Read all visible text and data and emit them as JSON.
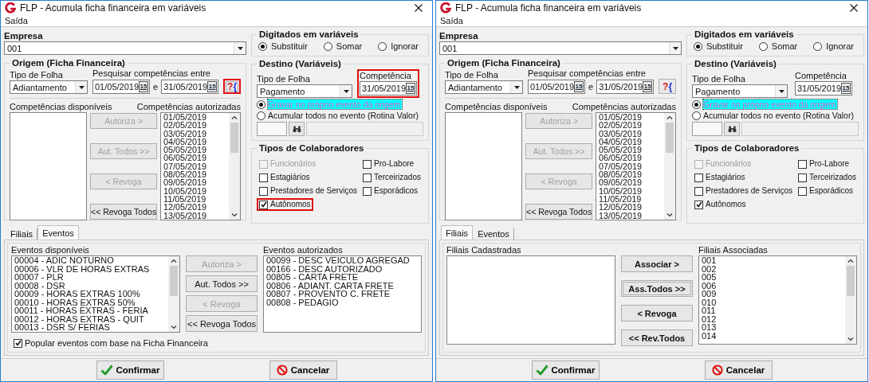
{
  "windows": [
    {
      "title": "FLP - Acumula ficha financeira em variáveis",
      "menu": [
        {
          "label": "Saída"
        }
      ],
      "empresa": {
        "label": "Empresa",
        "value": "001"
      },
      "digitados": {
        "title": "Digitados em variáveis",
        "options": [
          {
            "label": "Substituir",
            "selected": true
          },
          {
            "label": "Somar",
            "selected": false
          },
          {
            "label": "Ignorar",
            "selected": false
          }
        ]
      },
      "origem": {
        "title": "Origem (Ficha Financeira)",
        "tipo_label": "Tipo de Folha",
        "tipo_value": "Adiantamento",
        "range_label": "Pesquisar competências entre",
        "date_from": "01/05/2019",
        "range_separator": "e",
        "date_to": "31/05/2019",
        "picker_from": "15",
        "picker_to": "15",
        "help": {
          "label": "?{",
          "highlighted": true
        },
        "available": {
          "label": "Competências disponíveis"
        },
        "authorized": {
          "label": "Competências autorizadas",
          "scrollable": true,
          "items": [
            "01/05/2019",
            "02/05/2019",
            "03/05/2019",
            "04/05/2019",
            "05/05/2019",
            "06/05/2019",
            "07/05/2019",
            "08/05/2019",
            "09/05/2019",
            "10/05/2019",
            "11/05/2019",
            "12/05/2019",
            "13/05/2019"
          ]
        },
        "buttons": [
          {
            "label": "Autoriza >",
            "disabled": true
          },
          {
            "label": "Aut. Todos >>",
            "disabled": true
          },
          {
            "label": "< Revoga",
            "disabled": true
          },
          {
            "label": "<< Revoga Todos",
            "disabled": false
          }
        ]
      },
      "destino": {
        "title": "Destino (Variáveis)",
        "tipo_label": "Tipo de Folha",
        "tipo_value": "Pagamento",
        "competencia_label": "Competência",
        "competencia_value": "31/05/2019",
        "picker": "15",
        "highlighted": true,
        "options": [
          {
            "label": "Gravar no próprio evento da origem",
            "selected": true,
            "focused": true
          },
          {
            "label": "Acumular todos no evento (Rotina Valor)",
            "selected": false,
            "focused": false
          }
        ]
      },
      "tipos": {
        "title": "Tipos de Colaboradores",
        "items": [
          {
            "label": "Funcionários",
            "checked": false,
            "disabled": true,
            "highlighted": false
          },
          {
            "label": "Pro-Labore",
            "checked": false,
            "disabled": false,
            "highlighted": false
          },
          {
            "label": "Estagiários",
            "checked": false,
            "disabled": false,
            "highlighted": false
          },
          {
            "label": "Terceirizados",
            "checked": false,
            "disabled": false,
            "highlighted": false
          },
          {
            "label": "Prestadores de Serviços",
            "checked": false,
            "disabled": false,
            "highlighted": false
          },
          {
            "label": "Esporádicos",
            "checked": false,
            "disabled": false,
            "highlighted": false
          },
          {
            "label": "Autônomos",
            "checked": true,
            "disabled": false,
            "highlighted": true
          }
        ]
      },
      "tabs": [
        {
          "label": "Filiais",
          "selected": false
        },
        {
          "label": "Eventos",
          "selected": true
        }
      ],
      "panel": {
        "kind": "eventos",
        "left": {
          "label": "Eventos disponíveis",
          "scrollable": true,
          "items": [
            "00004 - ADIC NOTURNO",
            "00006 - VLR DE HORAS EXTRAS",
            "00007 - PLR",
            "00008 - DSR",
            "00009 - HORAS EXTRAS 100%",
            "00010 - HORAS EXTRAS 50%",
            "00011 - HORAS EXTRAS - FERIA",
            "00012 - HORAS EXTRAS - QUIT",
            "00013 - DSR S/ FERIAS"
          ]
        },
        "buttons": [
          {
            "label": "Autoriza >",
            "disabled": true
          },
          {
            "label": "Aut. Todos >>",
            "disabled": false
          },
          {
            "label": "< Revoga",
            "disabled": true
          },
          {
            "label": "<< Revoga Todos",
            "disabled": false
          }
        ],
        "right": {
          "label": "Eventos autorizados",
          "scrollable": false,
          "items": [
            "00099 - DESC VEICULO AGREGAD",
            "00166 - DESC AUTORIZADO",
            "00805 - CARTA FRETE",
            "00806 - ADIANT. CARTA FRETE",
            "00807 - PROVENTO C. FRETE",
            "00808 - PEDAGIO"
          ]
        },
        "option": {
          "label": "Popular eventos com base na Ficha Financeira",
          "checked": true
        }
      },
      "footer": [
        {
          "kind": "confirm",
          "label": "Confirmar"
        },
        {
          "kind": "cancel",
          "label": "Cancelar"
        }
      ]
    },
    {
      "title": "FLP - Acumula ficha financeira em variáveis",
      "menu": [
        {
          "label": "Saída"
        }
      ],
      "empresa": {
        "label": "Empresa",
        "value": "001"
      },
      "digitados": {
        "title": "Digitados em variáveis",
        "options": [
          {
            "label": "Substituir",
            "selected": true
          },
          {
            "label": "Somar",
            "selected": false
          },
          {
            "label": "Ignorar",
            "selected": false
          }
        ]
      },
      "origem": {
        "title": "Origem (Ficha Financeira)",
        "tipo_label": "Tipo de Folha",
        "tipo_value": "Adiantamento",
        "range_label": "Pesquisar competências entre",
        "date_from": "01/05/2019",
        "range_separator": "e",
        "date_to": "31/05/2019",
        "picker_from": "15",
        "picker_to": "15",
        "help": {
          "label": "?{",
          "highlighted": false
        },
        "available": {
          "label": "Competências disponíveis"
        },
        "authorized": {
          "label": "Competências autorizadas",
          "scrollable": true,
          "items": [
            "01/05/2019",
            "02/05/2019",
            "03/05/2019",
            "04/05/2019",
            "05/05/2019",
            "06/05/2019",
            "07/05/2019",
            "08/05/2019",
            "09/05/2019",
            "10/05/2019",
            "11/05/2019",
            "12/05/2019",
            "13/05/2019"
          ]
        },
        "buttons": [
          {
            "label": "Autoriza >",
            "disabled": true
          },
          {
            "label": "Aut. Todos >>",
            "disabled": true
          },
          {
            "label": "< Revoga",
            "disabled": true
          },
          {
            "label": "<< Revoga Todos",
            "disabled": false
          }
        ]
      },
      "destino": {
        "title": "Destino (Variáveis)",
        "tipo_label": "Tipo de Folha",
        "tipo_value": "Pagamento",
        "competencia_label": "Competência",
        "competencia_value": "31/05/2019",
        "picker": "15",
        "highlighted": false,
        "options": [
          {
            "label": "Gravar no próprio evento da origem",
            "selected": true,
            "focused": true
          },
          {
            "label": "Acumular todos no evento (Rotina Valor)",
            "selected": false,
            "focused": false
          }
        ]
      },
      "tipos": {
        "title": "Tipos de Colaboradores",
        "items": [
          {
            "label": "Funcionários",
            "checked": false,
            "disabled": true,
            "highlighted": false
          },
          {
            "label": "Pro-Labore",
            "checked": false,
            "disabled": false,
            "highlighted": false
          },
          {
            "label": "Estagiários",
            "checked": false,
            "disabled": false,
            "highlighted": false
          },
          {
            "label": "Terceirizados",
            "checked": false,
            "disabled": false,
            "highlighted": false
          },
          {
            "label": "Prestadores de Serviços",
            "checked": false,
            "disabled": false,
            "highlighted": false
          },
          {
            "label": "Esporádicos",
            "checked": false,
            "disabled": false,
            "highlighted": false
          },
          {
            "label": "Autônomos",
            "checked": true,
            "disabled": false,
            "highlighted": false
          }
        ]
      },
      "tabs": [
        {
          "label": "Filiais",
          "selected": true
        },
        {
          "label": "Eventos",
          "selected": false
        }
      ],
      "panel": {
        "kind": "filiais",
        "left": {
          "label": "Filiais Cadastradas",
          "scrollable": false
        },
        "buttons": [
          {
            "label": "Associar >",
            "highlighted": false
          },
          {
            "label": "Ass.Todos >>",
            "highlighted": true
          },
          {
            "label": "< Revoga",
            "highlighted": false
          },
          {
            "label": "<< Rev.Todos",
            "highlighted": false
          }
        ],
        "right": {
          "label": "Filiais Associadas",
          "scrollable": true,
          "items": [
            "001",
            "002",
            "005",
            "006",
            "009",
            "010",
            "011",
            "012",
            "013",
            "014"
          ]
        }
      },
      "footer": [
        {
          "kind": "confirm",
          "label": "Confirmar"
        },
        {
          "kind": "cancel",
          "label": "Cancelar"
        }
      ]
    }
  ]
}
